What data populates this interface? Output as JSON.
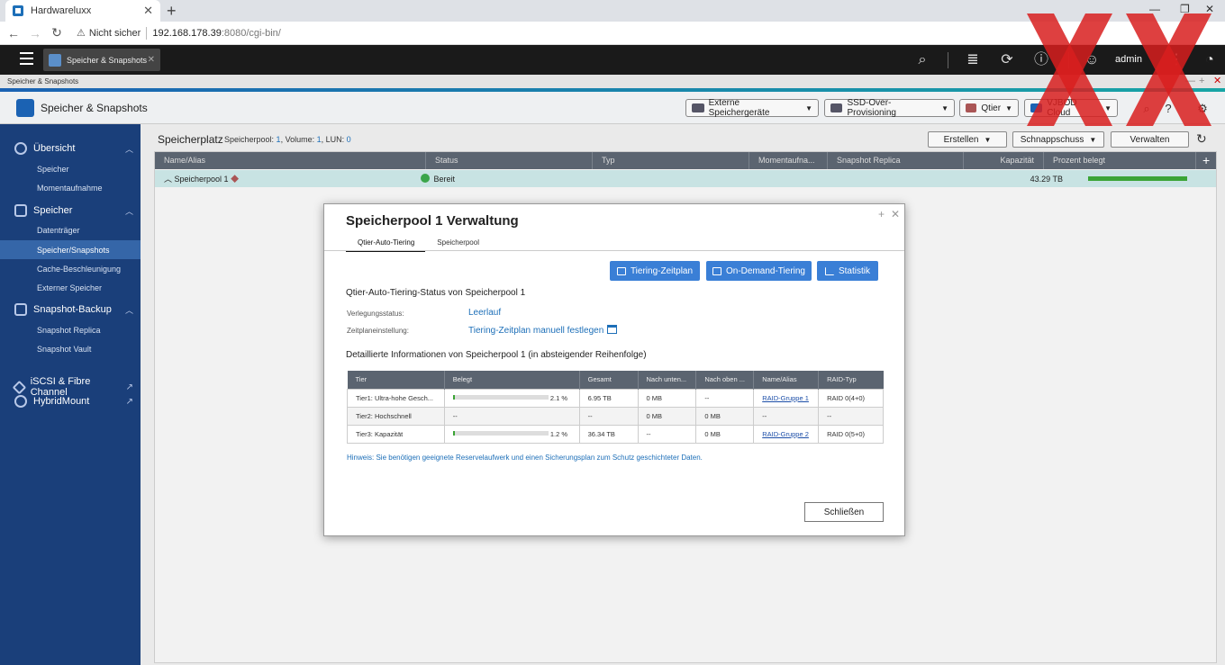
{
  "browser": {
    "tab_title": "Hardwareluxx",
    "url_warning": "Nicht sicher",
    "url_host": "192.168.178.39",
    "url_path": ":8080/cgi-bin/"
  },
  "topbar": {
    "app_tab": "Speicher & Snapshots",
    "user": "admin"
  },
  "window": {
    "title_small": "Speicher & Snapshots",
    "app_title": "Speicher & Snapshots"
  },
  "header_buttons": {
    "external": "Externe Speichergeräte",
    "ssd": "SSD-Over-Provisioning",
    "qtier": "Qtier",
    "vjbod": "VJBOD Cloud"
  },
  "sidebar": {
    "sections": [
      {
        "label": "Übersicht",
        "items": [
          "Speicher",
          "Momentaufnahme"
        ]
      },
      {
        "label": "Speicher",
        "items": [
          "Datenträger",
          "Speicher/Snapshots",
          "Cache-Beschleunigung",
          "Externer Speicher"
        ]
      },
      {
        "label": "Snapshot-Backup",
        "items": [
          "Snapshot Replica",
          "Snapshot Vault"
        ]
      }
    ],
    "links": [
      "iSCSI & Fibre Channel",
      "HybridMount"
    ]
  },
  "storage": {
    "title": "Speicherplatz",
    "pool_label": "Speicherpool: ",
    "pool_count": "1",
    "volume_label": ", Volume: ",
    "volume_count": "1",
    "lun_label": ", LUN: ",
    "lun_count": "0",
    "actions": {
      "create": "Erstellen",
      "snapshot": "Schnappschuss",
      "manage": "Verwalten"
    },
    "columns": [
      "Name/Alias",
      "Status",
      "Typ",
      "Momentaufna...",
      "Snapshot Replica",
      "Kapazität",
      "Prozent belegt"
    ],
    "row": {
      "name": "Speicherpool 1",
      "status": "Bereit",
      "capacity": "43.29 TB",
      "percent_used": 100
    }
  },
  "modal": {
    "title": "Speicherpool 1 Verwaltung",
    "tabs": [
      "Qtier-Auto-Tiering",
      "Speicherpool"
    ],
    "buttons": {
      "schedule": "Tiering-Zeitplan",
      "ondemand": "On-Demand-Tiering",
      "stats": "Statistik"
    },
    "status_heading": "Qtier-Auto-Tiering-Status von Speicherpool 1",
    "relocation_label": "Verlegungsstatus:",
    "relocation_value": "Leerlauf",
    "schedule_label": "Zeitplaneinstellung:",
    "schedule_value": "Tiering-Zeitplan manuell festlegen",
    "detail_heading": "Detaillierte Informationen von Speicherpool 1 (in absteigender Reihenfolge)",
    "table_headers": [
      "Tier",
      "Belegt",
      "Gesamt",
      "Nach unten...",
      "Nach oben ...",
      "Name/Alias",
      "RAID-Typ"
    ],
    "rows": [
      {
        "tier": "Tier1: Ultra-hohe Gesch...",
        "used_pct": 2.1,
        "used": "2.1 %",
        "total": "6.95 TB",
        "down": "0 MB",
        "up": "--",
        "alias": "RAID-Gruppe 1",
        "raid": "RAID 0(4+0)"
      },
      {
        "tier": "Tier2: Hochschnell",
        "used_pct": null,
        "used": "--",
        "total": "--",
        "down": "0 MB",
        "up": "0 MB",
        "alias": "--",
        "raid": "--"
      },
      {
        "tier": "Tier3: Kapazität",
        "used_pct": 1.2,
        "used": "1.2 %",
        "total": "36.34 TB",
        "down": "--",
        "up": "0 MB",
        "alias": "RAID-Gruppe 2",
        "raid": "RAID 0(5+0)"
      }
    ],
    "hint": "Hinweis: Sie benötigen geeignete Reservelaufwerk und einen Sicherungsplan zum Schutz geschichteter Daten.",
    "close": "Schließen"
  },
  "colors": {
    "accent": "#1b62b3",
    "sidebar": "#1a3f7a",
    "primary_button": "#3a7fd6",
    "ok": "#3aa54a",
    "watermark": "#d81e1e"
  }
}
